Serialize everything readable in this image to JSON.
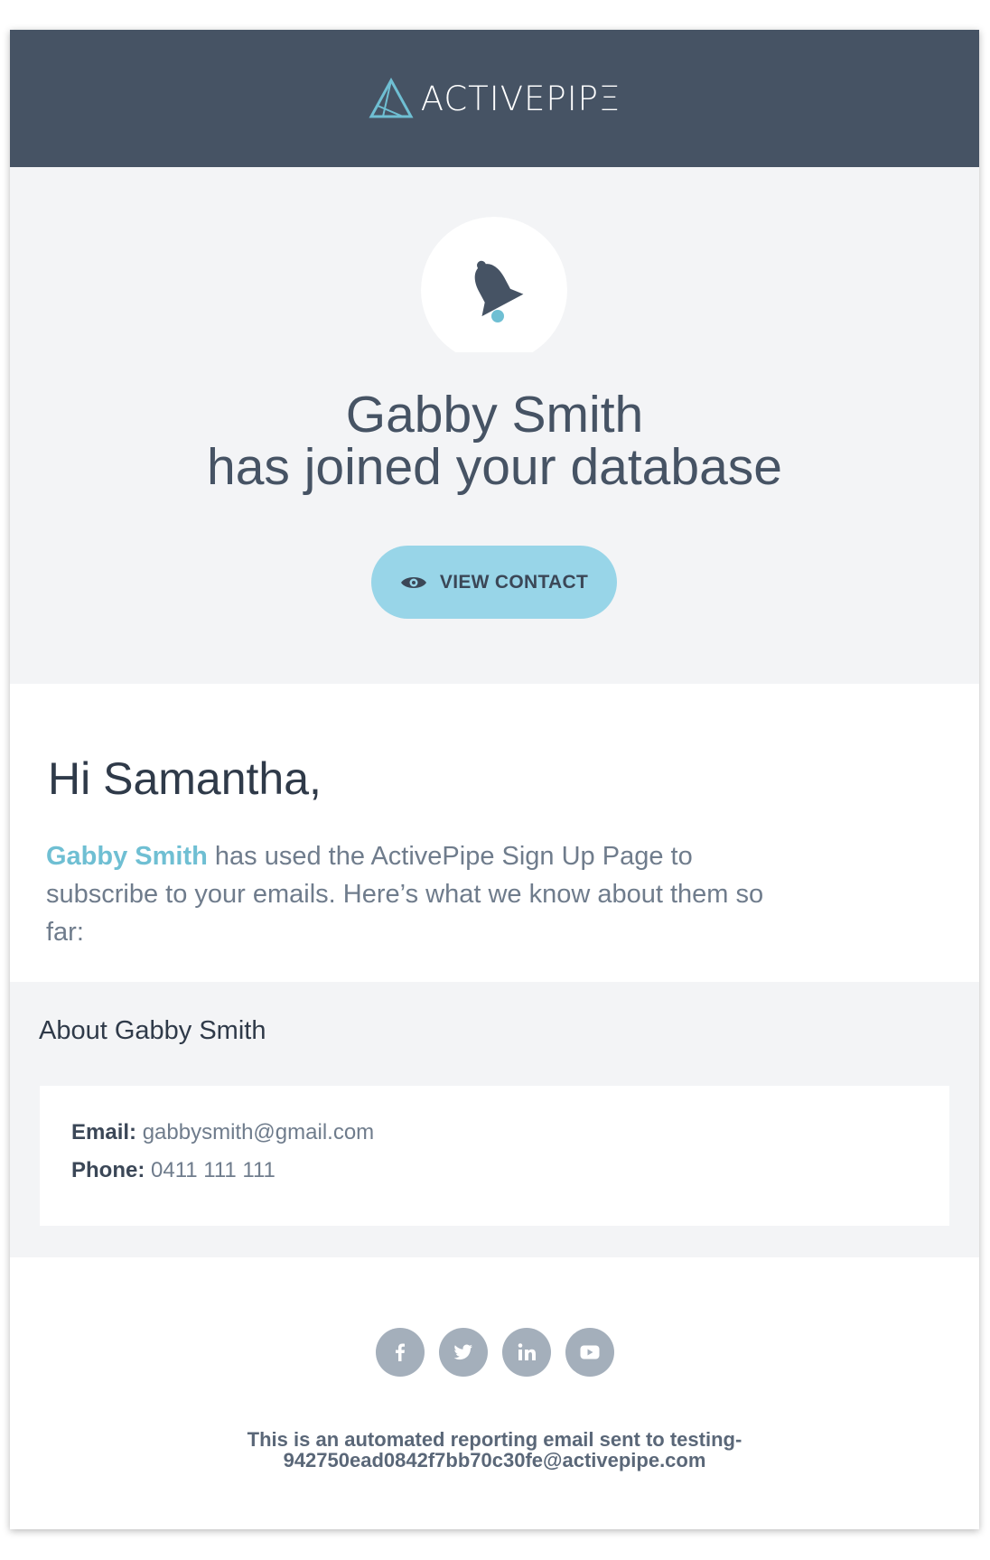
{
  "brand": {
    "logo_text": "ACTIVEPIPΞ",
    "accent": "#6fbfd3",
    "header_bg": "#465364"
  },
  "hero": {
    "icon": "bell-icon",
    "title_line1": "Gabby Smith",
    "title_line2": "has joined your database",
    "button_label": "VIEW CONTACT",
    "button_icon": "eye-icon"
  },
  "greeting": {
    "salutation": "Hi Samantha,",
    "contact_name": "Gabby Smith",
    "body_rest": " has used the ActivePipe Sign Up Page to subscribe to your emails. Here’s what we know about them so far:"
  },
  "about": {
    "heading": "About Gabby Smith",
    "email_label": "Email:",
    "email_value": "gabbysmith@gmail.com",
    "phone_label": "Phone:",
    "phone_value": "0411 111 111"
  },
  "footer": {
    "socials": [
      "facebook-icon",
      "twitter-icon",
      "linkedin-icon",
      "youtube-icon"
    ],
    "note_line1": "This is an automated reporting email sent to testing-",
    "note_line2": "942750ead0842f7bb70c30fe@activepipe.com"
  }
}
